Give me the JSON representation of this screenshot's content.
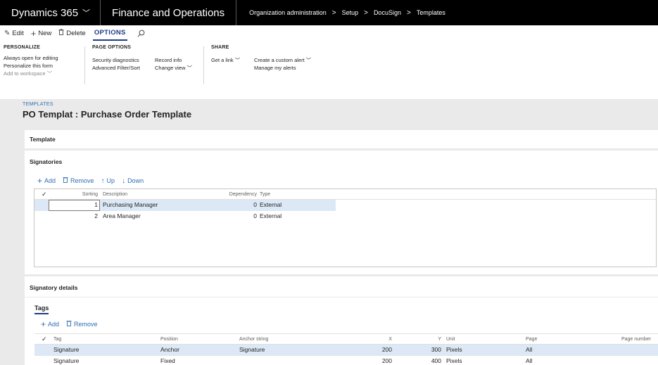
{
  "nav": {
    "app_name": "Dynamics 365",
    "module": "Finance and Operations",
    "breadcrumbs": [
      "Organization administration",
      "Setup",
      "DocuSign",
      "Templates"
    ]
  },
  "actions": {
    "edit": "Edit",
    "new": "New",
    "delete": "Delete",
    "options": "OPTIONS"
  },
  "ribbon": {
    "personalize": {
      "title": "PERSONALIZE",
      "items": [
        "Always open for editing",
        "Personalize this form",
        "Add to workspace"
      ]
    },
    "page_options": {
      "title": "PAGE OPTIONS",
      "col1": [
        "Security diagnostics",
        "Advanced Filter/Sort"
      ],
      "col2": [
        "Record info",
        "Change view"
      ]
    },
    "share": {
      "title": "SHARE",
      "col1": [
        "Get a link"
      ],
      "col2": [
        "Create a custom alert",
        "Manage my alerts"
      ]
    }
  },
  "page": {
    "caption": "TEMPLATES",
    "title": "PO Templat : Purchase Order Template"
  },
  "template_tab": {
    "label": "Template"
  },
  "signatories": {
    "label": "Signatories",
    "toolbar": {
      "add": "Add",
      "remove": "Remove",
      "up": "Up",
      "down": "Down"
    },
    "columns": {
      "sorting": "Sorting",
      "description": "Description",
      "dependency": "Dependency",
      "type": "Type"
    },
    "rows": [
      {
        "sorting": "1",
        "description": "Purchasing Manager",
        "dependency": "0",
        "type": "External"
      },
      {
        "sorting": "2",
        "description": "Area Manager",
        "dependency": "0",
        "type": "External"
      }
    ]
  },
  "signatory_details": {
    "label": "Signatory details",
    "tab_tags": "Tags",
    "toolbar": {
      "add": "Add",
      "remove": "Remove"
    },
    "columns": {
      "tag": "Tag",
      "position": "Position",
      "anchor": "Anchor string",
      "x": "X",
      "y": "Y",
      "unit": "Unit",
      "page": "Page",
      "page_number": "Page number"
    },
    "rows": [
      {
        "tag": "Signature",
        "position": "Anchor",
        "anchor": "Signature",
        "x": "200",
        "y": "300",
        "unit": "Pixels",
        "page": "All",
        "page_number": ""
      },
      {
        "tag": "Signature",
        "position": "Fixed",
        "anchor": "",
        "x": "200",
        "y": "400",
        "unit": "Pixels",
        "page": "All",
        "page_number": ""
      }
    ]
  },
  "icons": {
    "chevron": "⌵",
    "check": "✓",
    "edit": "✎",
    "plus": "+",
    "trash": "🗑",
    "up": "↑",
    "down": "↓",
    "search": "⌕"
  }
}
